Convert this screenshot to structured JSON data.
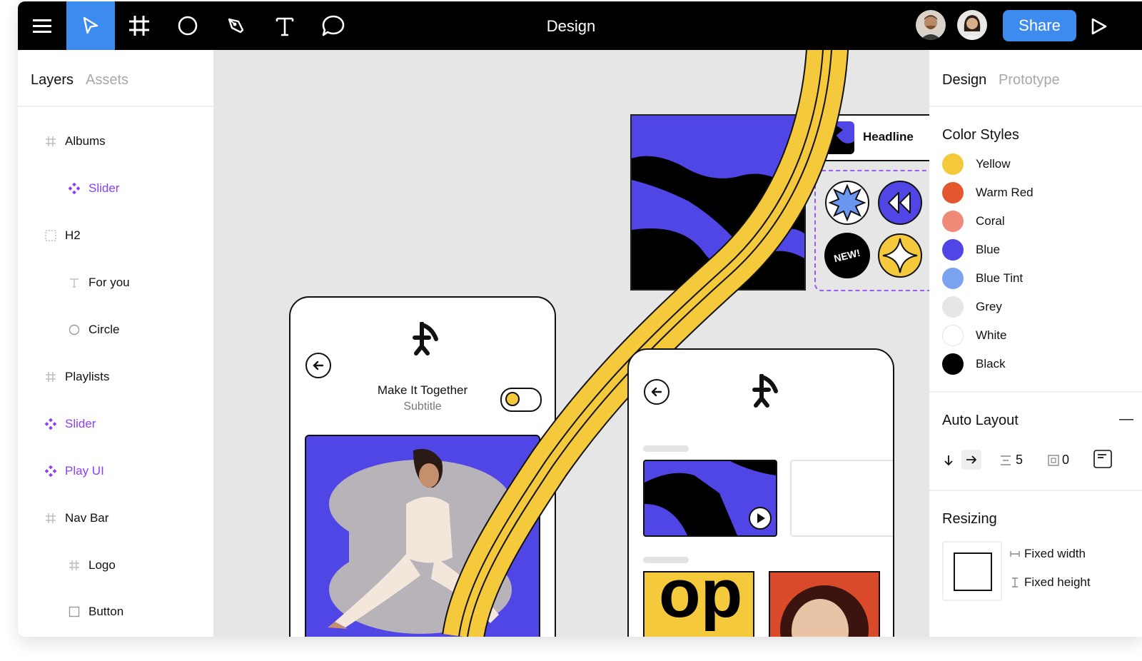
{
  "toolbar": {
    "title": "Design",
    "share_label": "Share",
    "tools": [
      "menu-icon",
      "move-icon",
      "frame-icon",
      "ellipse-icon",
      "pen-icon",
      "text-icon",
      "comment-icon"
    ]
  },
  "left_panel": {
    "tabs": {
      "active": "Layers",
      "inactive": "Assets"
    },
    "layers": [
      {
        "label": "Albums",
        "icon": "frame-icon",
        "indent": 0,
        "purple": false
      },
      {
        "label": "Slider",
        "icon": "component-icon",
        "indent": 1,
        "purple": true
      },
      {
        "label": "H2",
        "icon": "group-icon",
        "indent": 0,
        "purple": false
      },
      {
        "label": "For you",
        "icon": "text-icon",
        "indent": 1,
        "purple": false
      },
      {
        "label": "Circle",
        "icon": "ellipse-icon",
        "indent": 1,
        "purple": false
      },
      {
        "label": "Playlists",
        "icon": "frame-icon",
        "indent": 0,
        "purple": false
      },
      {
        "label": "Slider",
        "icon": "component-icon",
        "indent": 0,
        "purple": true
      },
      {
        "label": "Play UI",
        "icon": "component-icon",
        "indent": 0,
        "purple": true
      },
      {
        "label": "Nav Bar",
        "icon": "frame-icon",
        "indent": 0,
        "purple": false
      },
      {
        "label": "Logo",
        "icon": "frame-icon",
        "indent": 1,
        "purple": false
      },
      {
        "label": "Button",
        "icon": "rectangle-icon",
        "indent": 1,
        "purple": false
      }
    ]
  },
  "canvas": {
    "headline_label": "Headline",
    "badge_new": "NEW!",
    "phone1": {
      "title": "Make It Together",
      "subtitle": "Subtitle"
    },
    "album_text": "op"
  },
  "right_panel": {
    "tabs": {
      "active": "Design",
      "inactive": "Prototype"
    },
    "color_styles_title": "Color Styles",
    "colors": [
      {
        "name": "Yellow",
        "hex": "#f5c93c"
      },
      {
        "name": "Warm Red",
        "hex": "#e4572e"
      },
      {
        "name": "Coral",
        "hex": "#ef8a78"
      },
      {
        "name": "Blue",
        "hex": "#4f46e5"
      },
      {
        "name": "Blue Tint",
        "hex": "#7aa2f0"
      },
      {
        "name": "Grey",
        "hex": "#e6e6e6"
      },
      {
        "name": "White",
        "hex": "#ffffff"
      },
      {
        "name": "Black",
        "hex": "#000000"
      }
    ],
    "auto_layout": {
      "title": "Auto Layout",
      "collapse_symbol": "—",
      "spacing": "5",
      "padding": "0"
    },
    "resizing": {
      "title": "Resizing",
      "width_mode": "Fixed width",
      "height_mode": "Fixed height"
    }
  },
  "colors": {
    "accent": "#3e8bf0",
    "brand_purple": "#8a3ff6",
    "indigo": "#5046e6",
    "yellow": "#f5c93c"
  }
}
